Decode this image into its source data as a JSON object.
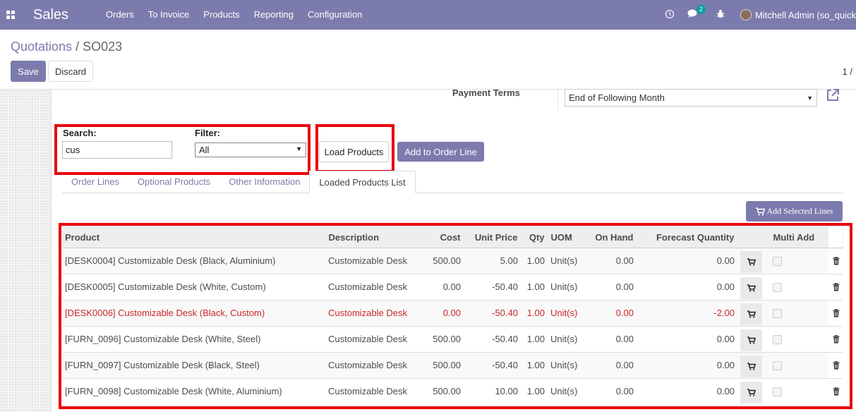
{
  "navbar": {
    "brand": "Sales",
    "menu": [
      "Orders",
      "To Invoice",
      "Products",
      "Reporting",
      "Configuration"
    ],
    "chat_badge": "2",
    "user": "Mitchell Admin (so_quick"
  },
  "breadcrumb": {
    "parent": "Quotations",
    "sep": "/",
    "current": "SO023"
  },
  "buttons": {
    "save": "Save",
    "discard": "Discard",
    "load_products": "Load Products",
    "add_to_order_line": "Add to Order Line",
    "add_selected_lines": "Add Selected Lines"
  },
  "pager": "1 /",
  "payment_terms": {
    "label": "Payment Terms",
    "value": "End of Following Month"
  },
  "search": {
    "label": "Search:",
    "value": "cus"
  },
  "filter": {
    "label": "Filter:",
    "value": "All"
  },
  "tabs": [
    "Order Lines",
    "Optional Products",
    "Other Information",
    "Loaded Products List"
  ],
  "table": {
    "headers": [
      "Product",
      "Description",
      "Cost",
      "Unit Price",
      "Qty",
      "UOM",
      "On Hand",
      "Forecast Quantity",
      "",
      "Multi Add",
      ""
    ],
    "rows": [
      {
        "product": "[DESK0004] Customizable Desk (Black, Aluminium)",
        "description": "Customizable Desk",
        "cost": "500.00",
        "unit_price": "5.00",
        "qty": "1.00",
        "uom": "Unit(s)",
        "on_hand": "0.00",
        "forecast": "0.00",
        "warn": false
      },
      {
        "product": "[DESK0005] Customizable Desk (White, Custom)",
        "description": "Customizable Desk",
        "cost": "0.00",
        "unit_price": "-50.40",
        "qty": "1.00",
        "uom": "Unit(s)",
        "on_hand": "0.00",
        "forecast": "0.00",
        "warn": false
      },
      {
        "product": "[DESK0006] Customizable Desk (Black, Custom)",
        "description": "Customizable Desk",
        "cost": "0.00",
        "unit_price": "-50.40",
        "qty": "1.00",
        "uom": "Unit(s)",
        "on_hand": "0.00",
        "forecast": "-2.00",
        "warn": true
      },
      {
        "product": "[FURN_0096] Customizable Desk (White, Steel)",
        "description": "Customizable Desk",
        "cost": "500.00",
        "unit_price": "-50.40",
        "qty": "1.00",
        "uom": "Unit(s)",
        "on_hand": "0.00",
        "forecast": "0.00",
        "warn": false
      },
      {
        "product": "[FURN_0097] Customizable Desk (Black, Steel)",
        "description": "Customizable Desk",
        "cost": "500.00",
        "unit_price": "-50.40",
        "qty": "1.00",
        "uom": "Unit(s)",
        "on_hand": "0.00",
        "forecast": "0.00",
        "warn": false
      },
      {
        "product": "[FURN_0098] Customizable Desk (White, Aluminium)",
        "description": "Customizable Desk",
        "cost": "500.00",
        "unit_price": "10.00",
        "qty": "1.00",
        "uom": "Unit(s)",
        "on_hand": "0.00",
        "forecast": "0.00",
        "warn": false
      }
    ]
  },
  "colors": {
    "brand": "#7c7bad",
    "highlight_box": "#e8000b",
    "warning_text": "#c9292c"
  },
  "icons": {
    "apps": "apps-grid-icon",
    "clock": "clock-icon",
    "chat": "chat-icon",
    "bug": "bug-icon",
    "external": "external-link-icon",
    "cart": "cart-icon",
    "trash": "trash-icon"
  }
}
